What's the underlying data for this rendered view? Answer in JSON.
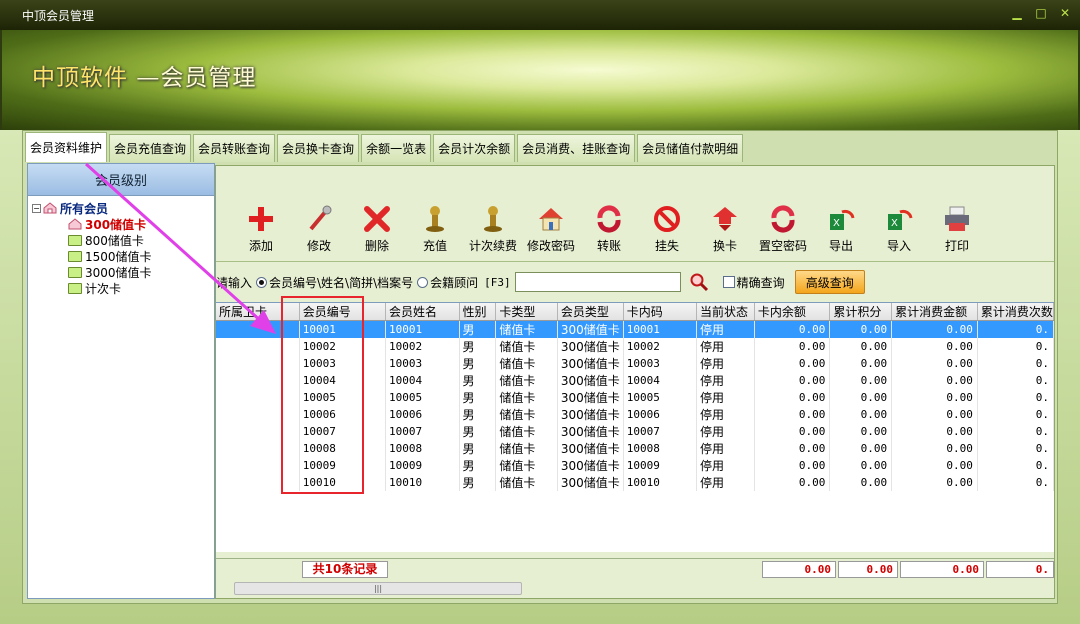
{
  "window": {
    "title": "中顶会员管理",
    "minimize": "▁",
    "maximize": "□",
    "close": "✕"
  },
  "banner": {
    "brand": "中顶软件",
    "product": "—会员管理"
  },
  "tabs": [
    {
      "label": "会员资料维护",
      "active": true
    },
    {
      "label": "会员充值查询"
    },
    {
      "label": "会员转账查询"
    },
    {
      "label": "会员换卡查询"
    },
    {
      "label": "余额一览表"
    },
    {
      "label": "会员计次余额"
    },
    {
      "label": "会员消费、挂账查询"
    },
    {
      "label": "会员储值付款明细"
    }
  ],
  "sidebar": {
    "title": "会员级别",
    "root": "所有会员",
    "root_toggle": "−",
    "items": [
      "300储值卡",
      "800储值卡",
      "1500储值卡",
      "3000储值卡",
      "计次卡"
    ]
  },
  "toolbar": [
    {
      "label": "添加",
      "icon": "add-icon"
    },
    {
      "label": "修改",
      "icon": "edit-icon"
    },
    {
      "label": "删除",
      "icon": "delete-icon"
    },
    {
      "label": "充值",
      "icon": "recharge-icon"
    },
    {
      "label": "计次续费",
      "icon": "renew-icon"
    },
    {
      "label": "修改密码",
      "icon": "password-icon"
    },
    {
      "label": "转账",
      "icon": "transfer-icon"
    },
    {
      "label": "挂失",
      "icon": "report-loss-icon"
    },
    {
      "label": "换卡",
      "icon": "change-card-icon"
    },
    {
      "label": "置空密码",
      "icon": "clear-password-icon"
    },
    {
      "label": "导出",
      "icon": "export-icon"
    },
    {
      "label": "导入",
      "icon": "import-icon"
    },
    {
      "label": "打印",
      "icon": "print-icon"
    }
  ],
  "search": {
    "prompt": "请输入",
    "option1": "会员编号\\姓名\\简拼\\档案号",
    "option2": "会籍顾问",
    "shortcut": "[F3]",
    "value": "",
    "exact": "精确查询",
    "advanced": "高级查询"
  },
  "table": {
    "columns": [
      "所属卫卡",
      "会员编号",
      "会员姓名",
      "性别",
      "卡类型",
      "会员类型",
      "卡内码",
      "当前状态",
      "卡内余额",
      "累计积分",
      "累计消费金额",
      "累计消费次数"
    ],
    "rows": [
      [
        "",
        "10001",
        "10001",
        "男",
        "储值卡",
        "300储值卡",
        "10001",
        "停用",
        "0.00",
        "0.00",
        "0.00",
        "0."
      ],
      [
        "",
        "10002",
        "10002",
        "男",
        "储值卡",
        "300储值卡",
        "10002",
        "停用",
        "0.00",
        "0.00",
        "0.00",
        "0."
      ],
      [
        "",
        "10003",
        "10003",
        "男",
        "储值卡",
        "300储值卡",
        "10003",
        "停用",
        "0.00",
        "0.00",
        "0.00",
        "0."
      ],
      [
        "",
        "10004",
        "10004",
        "男",
        "储值卡",
        "300储值卡",
        "10004",
        "停用",
        "0.00",
        "0.00",
        "0.00",
        "0."
      ],
      [
        "",
        "10005",
        "10005",
        "男",
        "储值卡",
        "300储值卡",
        "10005",
        "停用",
        "0.00",
        "0.00",
        "0.00",
        "0."
      ],
      [
        "",
        "10006",
        "10006",
        "男",
        "储值卡",
        "300储值卡",
        "10006",
        "停用",
        "0.00",
        "0.00",
        "0.00",
        "0."
      ],
      [
        "",
        "10007",
        "10007",
        "男",
        "储值卡",
        "300储值卡",
        "10007",
        "停用",
        "0.00",
        "0.00",
        "0.00",
        "0."
      ],
      [
        "",
        "10008",
        "10008",
        "男",
        "储值卡",
        "300储值卡",
        "10008",
        "停用",
        "0.00",
        "0.00",
        "0.00",
        "0."
      ],
      [
        "",
        "10009",
        "10009",
        "男",
        "储值卡",
        "300储值卡",
        "10009",
        "停用",
        "0.00",
        "0.00",
        "0.00",
        "0."
      ],
      [
        "",
        "10010",
        "10010",
        "男",
        "储值卡",
        "300储值卡",
        "10010",
        "停用",
        "0.00",
        "0.00",
        "0.00",
        "0."
      ]
    ]
  },
  "footer": {
    "total": "共10条记录",
    "sum_balance": "0.00",
    "sum_points": "0.00",
    "sum_amount": "0.00",
    "sum_count": "0.",
    "scroll_grip": "|||"
  },
  "colors": {
    "selected_row": "#3399ff",
    "annotation_box": "#e8242c",
    "annotation_arrow": "#e040e8"
  }
}
